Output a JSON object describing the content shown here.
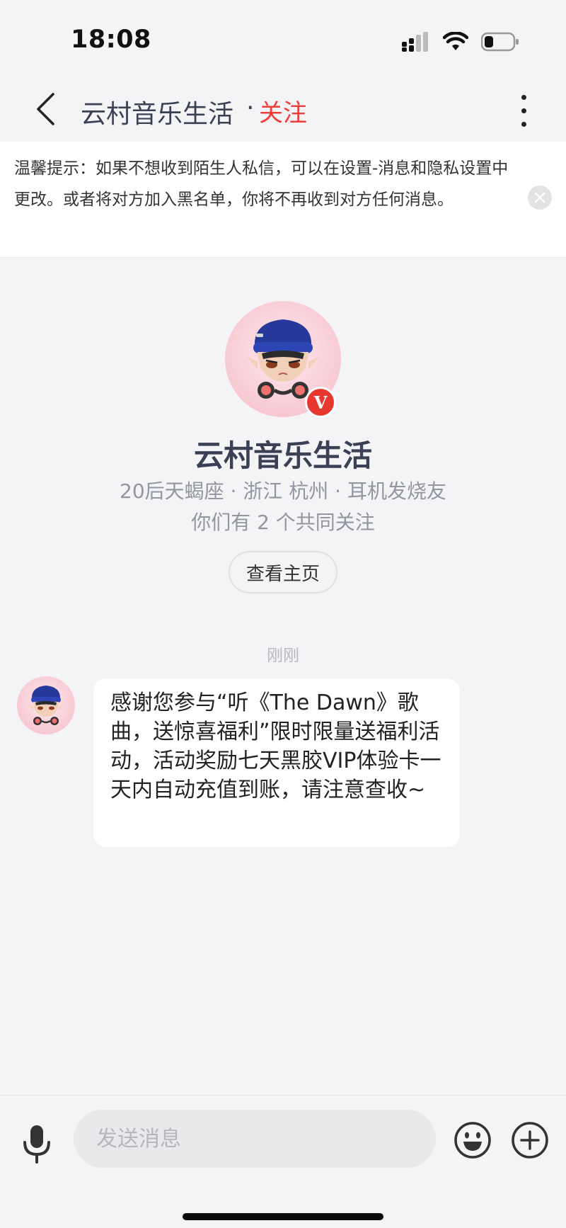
{
  "status_bar": {
    "time": "18:08",
    "icons": [
      "signal-icon",
      "wifi-icon",
      "battery-icon"
    ]
  },
  "header": {
    "title": "云村音乐生活",
    "dot": "·",
    "follow_label": "关注",
    "icons": [
      "back-arrow-icon",
      "more-vertical-icon"
    ]
  },
  "tip": {
    "text": "温馨提示：如果不想收到陌生人私信，可以在设置-消息和隐私设置中更改。或者将对方加入黑名单，你将不再收到对方任何消息。",
    "close_icon": "close-icon"
  },
  "profile": {
    "name": "云村音乐生活",
    "meta": "20后天蝎座 · 浙江 杭州 · 耳机发烧友",
    "common_follow": "你们有 2 个共同关注",
    "verified_badge": "V",
    "view_home_label": "查看主页"
  },
  "chat": {
    "timestamp": "刚刚",
    "messages": [
      {
        "text": "感谢您参与“听《The Dawn》歌曲，送惊喜福利”限时限量送福利活动，活动奖励七天黑胶VIP体验卡一天内自动充值到账，请注意查收~"
      }
    ]
  },
  "input_bar": {
    "placeholder": "发送消息",
    "icons": [
      "microphone-icon",
      "emoji-icon",
      "plus-icon"
    ]
  },
  "colors": {
    "accent_red": "#ef3d3a",
    "background": "#f4f4f6",
    "title_text": "#3a4154",
    "muted_text": "#9296a1"
  }
}
